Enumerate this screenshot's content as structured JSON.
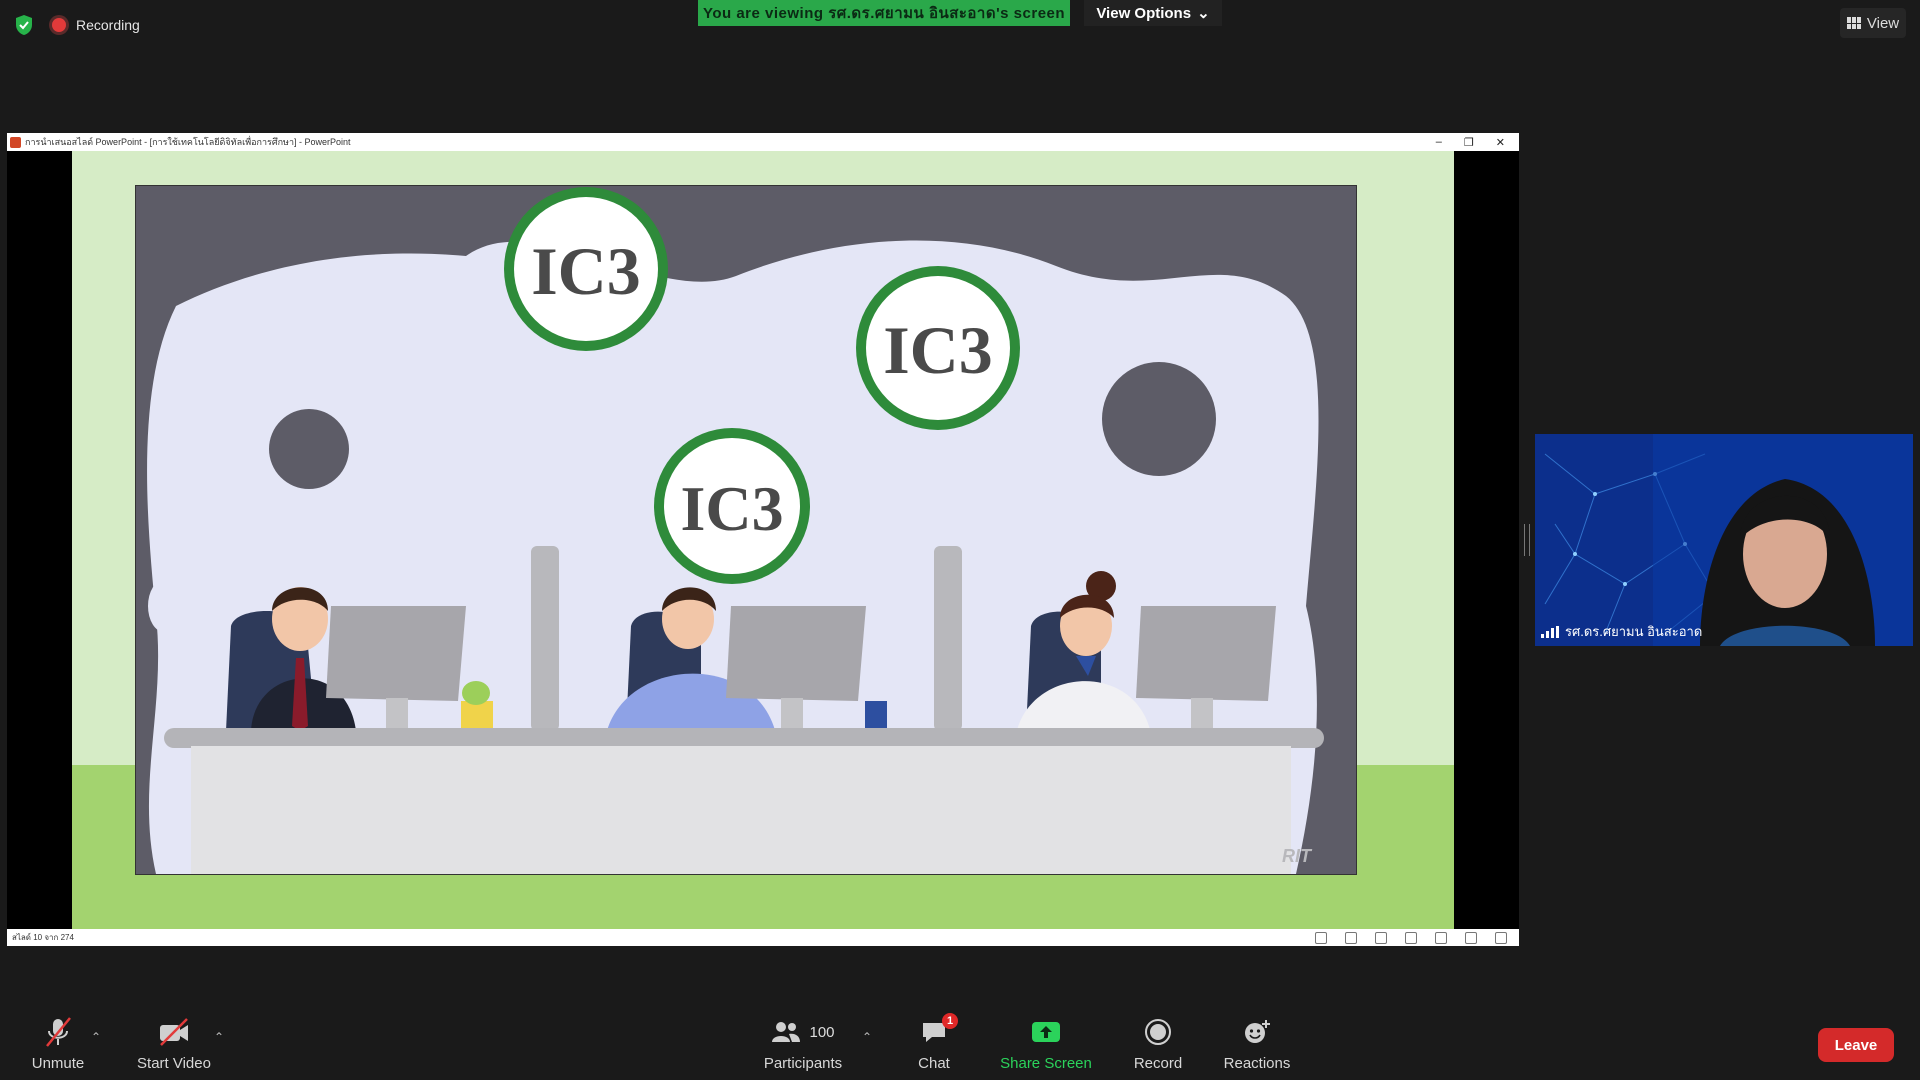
{
  "top": {
    "recording_label": "Recording",
    "viewing_banner": "You are viewing รศ.ดร.ศยามน อินสะอาด's screen",
    "view_options_label": "View Options",
    "view_label": "View"
  },
  "powerpoint": {
    "title": "การนำเสนอสไลด์ PowerPoint - [การใช้เทคโนโลยีดิจิทัลเพื่อการศึกษา] - PowerPoint",
    "status_slide": "สไลด์ 10 จาก 274",
    "slide": {
      "badge_text": "IC3",
      "watermark": "RIT"
    }
  },
  "participant": {
    "name": "รศ.ดร.ศยามน อินสะอาด"
  },
  "toolbar": {
    "unmute": "Unmute",
    "start_video": "Start Video",
    "participants": "Participants",
    "participants_count": "100",
    "chat": "Chat",
    "chat_badge": "1",
    "share_screen": "Share Screen",
    "record": "Record",
    "reactions": "Reactions",
    "leave": "Leave"
  },
  "colors": {
    "banner_green": "#2aa84a",
    "share_green": "#2bd35b",
    "leave_red": "#d42a2a",
    "ic3_green": "#2e8b3a"
  }
}
